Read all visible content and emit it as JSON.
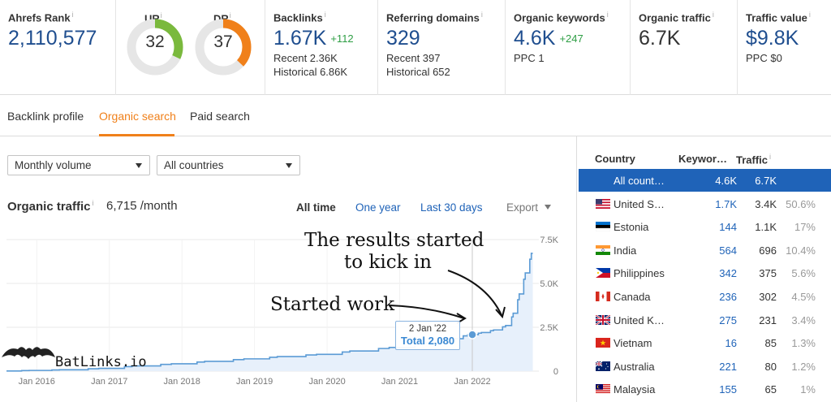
{
  "metrics": {
    "ahrefs_rank": {
      "label": "Ahrefs Rank",
      "value": "2,110,577"
    },
    "ur": {
      "label": "UR",
      "value": "32",
      "fraction": 0.32,
      "color": "#7ab93d"
    },
    "dr": {
      "label": "DR",
      "value": "37",
      "fraction": 0.37,
      "color": "#f0801a"
    },
    "backlinks": {
      "label": "Backlinks",
      "value": "1.67K",
      "delta": "+112",
      "recent": "Recent 2.36K",
      "historical": "Historical 6.86K"
    },
    "referring_domains": {
      "label": "Referring domains",
      "value": "329",
      "recent": "Recent 397",
      "historical": "Historical 652"
    },
    "organic_keywords": {
      "label": "Organic keywords",
      "value": "4.6K",
      "delta": "+247",
      "ppc": "PPC 1"
    },
    "organic_traffic": {
      "label": "Organic traffic",
      "value": "6.7K"
    },
    "traffic_value": {
      "label": "Traffic value",
      "value": "$9.8K",
      "ppc": "PPC $0"
    },
    "info_icon": "i"
  },
  "tabs": [
    "Backlink profile",
    "Organic search",
    "Paid search"
  ],
  "active_tab": "Organic search",
  "filters": {
    "volume": "Monthly volume",
    "countries": "All countries"
  },
  "chart_header": {
    "title": "Organic traffic",
    "value": "6,715 /month",
    "ranges": [
      "All time",
      "One year",
      "Last 30 days"
    ],
    "active_range": "All time",
    "export": "Export"
  },
  "chart_data": {
    "type": "area",
    "x_labels": [
      "Jan 2016",
      "Jan 2017",
      "Jan 2018",
      "Jan 2019",
      "Jan 2020",
      "Jan 2021",
      "Jan 2022"
    ],
    "y_ticks": [
      "7.5K",
      "5.0K",
      "2.5K",
      "0"
    ],
    "ylim": [
      0,
      7500
    ],
    "series_color": "#5b9bd5",
    "points": [
      [
        "2015-08",
        10
      ],
      [
        "2016-01",
        40
      ],
      [
        "2016-06",
        80
      ],
      [
        "2017-01",
        160
      ],
      [
        "2017-06",
        300
      ],
      [
        "2018-01",
        420
      ],
      [
        "2018-06",
        560
      ],
      [
        "2019-01",
        700
      ],
      [
        "2019-06",
        830
      ],
      [
        "2020-01",
        960
      ],
      [
        "2020-06",
        1150
      ],
      [
        "2021-01",
        1350
      ],
      [
        "2021-06",
        1600
      ],
      [
        "2021-10",
        1850
      ],
      [
        "2022-01",
        2080
      ],
      [
        "2022-03",
        2200
      ],
      [
        "2022-05",
        2350
      ],
      [
        "2022-07",
        2600
      ],
      [
        "2022-08",
        3300
      ],
      [
        "2022-09",
        4400
      ],
      [
        "2022-10",
        5600
      ],
      [
        "2022-11",
        6715
      ]
    ],
    "tooltip": {
      "date": "2 Jan '22",
      "total": "Total 2,080"
    }
  },
  "annotations": {
    "started": "Started work",
    "results_line1": "The results started",
    "results_line2": "to kick in"
  },
  "watermark": "BatLinks.io",
  "country_table": {
    "headers": {
      "country": "Country",
      "keywords": "Keywor…",
      "traffic": "Traffic"
    },
    "rows": [
      {
        "country": "All count…",
        "keywords": "4.6K",
        "traffic": "6.7K",
        "pct": "",
        "flag": "none",
        "selected": true
      },
      {
        "country": "United S…",
        "keywords": "1.7K",
        "traffic": "3.4K",
        "pct": "50.6%",
        "flag": "us-flag"
      },
      {
        "country": "Estonia",
        "keywords": "144",
        "traffic": "1.1K",
        "pct": "17%",
        "flag": "ee-flag"
      },
      {
        "country": "India",
        "keywords": "564",
        "traffic": "696",
        "pct": "10.4%",
        "flag": "in-flag"
      },
      {
        "country": "Philippines",
        "keywords": "342",
        "traffic": "375",
        "pct": "5.6%",
        "flag": "ph-flag"
      },
      {
        "country": "Canada",
        "keywords": "236",
        "traffic": "302",
        "pct": "4.5%",
        "flag": "ca-flag"
      },
      {
        "country": "United K…",
        "keywords": "275",
        "traffic": "231",
        "pct": "3.4%",
        "flag": "gb-flag"
      },
      {
        "country": "Vietnam",
        "keywords": "16",
        "traffic": "85",
        "pct": "1.3%",
        "flag": "vn-flag"
      },
      {
        "country": "Australia",
        "keywords": "221",
        "traffic": "80",
        "pct": "1.2%",
        "flag": "au-flag"
      },
      {
        "country": "Malaysia",
        "keywords": "155",
        "traffic": "65",
        "pct": "1%",
        "flag": "my-flag"
      }
    ]
  }
}
